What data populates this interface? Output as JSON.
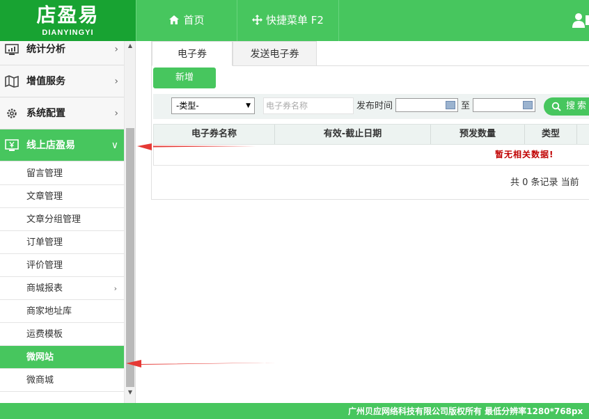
{
  "logo": {
    "cn": "店盈易",
    "en": "DIANYINGYI"
  },
  "topnav": {
    "home": "首页",
    "quick_menu": "快捷菜单 F2"
  },
  "sidebar": {
    "main": [
      {
        "label": "统计分析"
      },
      {
        "label": "增值服务"
      },
      {
        "label": "系统配置"
      },
      {
        "label": "线上店盈易"
      }
    ],
    "sub": [
      {
        "label": "留言管理"
      },
      {
        "label": "文章管理"
      },
      {
        "label": "文章分组管理"
      },
      {
        "label": "订单管理"
      },
      {
        "label": "评价管理"
      },
      {
        "label": "商城报表"
      },
      {
        "label": "商家地址库"
      },
      {
        "label": "运费模板"
      },
      {
        "label": "微网站"
      },
      {
        "label": "微商城"
      }
    ]
  },
  "tabs": [
    "电子券",
    "发送电子券"
  ],
  "toolbar": {
    "add": "新增"
  },
  "filter": {
    "type_select": "-类型-",
    "name_placeholder": "电子券名称",
    "time_label": "发布时间",
    "to_label": "至",
    "search": "搜索"
  },
  "table": {
    "headers": [
      "电子券名称",
      "有效-截止日期",
      "预发数量",
      "类型"
    ],
    "empty": "暂无相关数据!"
  },
  "pager": {
    "text": "共 0 条记录 当前"
  },
  "footer": {
    "text": "广州贝应网络科技有限公司版权所有 最低分辨率1280*768px"
  },
  "colors": {
    "accent": "#47c65e",
    "logo_bg": "#18a332",
    "empty": "#c00000",
    "arrow": "#e53935"
  }
}
